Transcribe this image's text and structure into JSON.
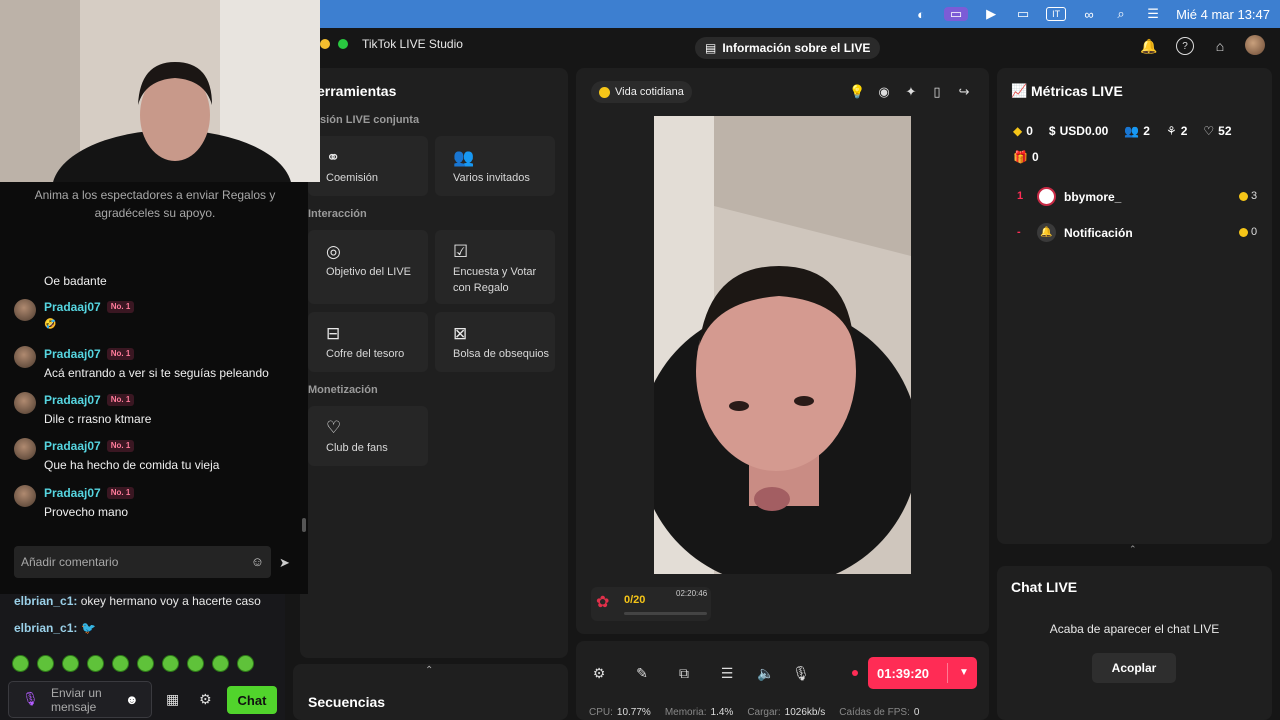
{
  "menubar": {
    "datetime": "Mié 4 mar 13:47",
    "lang": "IT"
  },
  "window": {
    "title": "TikTok LIVE Studio",
    "info_button": "Información sobre el LIVE"
  },
  "tools": {
    "title": "erramientas",
    "sec1": "isión LIVE conjunta",
    "commission": "Coemisión",
    "multi_guest": "Varios invitados",
    "sec2": "Interacción",
    "live_goal": "Objetivo del LIVE",
    "poll": "Encuesta y Votar con Regalo",
    "treasure": "Cofre del tesoro",
    "gift_bag": "Bolsa de obsequios",
    "sec3": "Monetización",
    "fan_club": "Club de fans"
  },
  "sequences": {
    "label": "Secuencias"
  },
  "preview": {
    "category": "Vida cotidiana",
    "goal_count": "0/20",
    "goal_timer": "02:20:46"
  },
  "controls": {
    "timer": "01:39:20",
    "cpu_label": "CPU:",
    "cpu": "10.77%",
    "mem_label": "Memoria:",
    "mem": "1.4%",
    "upload_label": "Cargar:",
    "upload": "1026kb/s",
    "fps_label": "Caídas de FPS:",
    "fps": "0"
  },
  "metrics": {
    "title": "Métricas LIVE",
    "diamonds": "0",
    "usd": "USD0.00",
    "viewers": "2",
    "new_followers": "2",
    "likes": "52",
    "gifts": "0",
    "ranking": [
      {
        "rank": "1",
        "name": "bbymore_",
        "coins": "3"
      },
      {
        "rank": "-",
        "name": "Notificación",
        "coins": "0"
      }
    ]
  },
  "chat_live": {
    "title": "Chat LIVE",
    "message": "Acaba de aparecer el chat LIVE",
    "dock": "Acoplar"
  },
  "comments": {
    "hint": "Anima a los espectadores a enviar Regalos y agradéceles su apoyo.",
    "partial": "Oe badante",
    "badge": "No. 1",
    "items": [
      {
        "user": "Pradaaj07",
        "text": "🤣"
      },
      {
        "user": "Pradaaj07",
        "text": "Acá entrando a ver si te seguías peleando"
      },
      {
        "user": "Pradaaj07",
        "text": "Dile c rrasno ktmare"
      },
      {
        "user": "Pradaaj07",
        "text": "Que ha hecho de comida tu vieja"
      },
      {
        "user": "Pradaaj07",
        "text": "Provecho mano"
      }
    ],
    "placeholder": "Añadir comentario"
  },
  "twitch": {
    "msg1_user": "elbrian_c1:",
    "msg1_text": " okey hermano voy a hacerte caso",
    "msg2_user": "elbrian_c1:",
    "input_placeholder": "Enviar un mensaje",
    "chat_button": "Chat"
  }
}
